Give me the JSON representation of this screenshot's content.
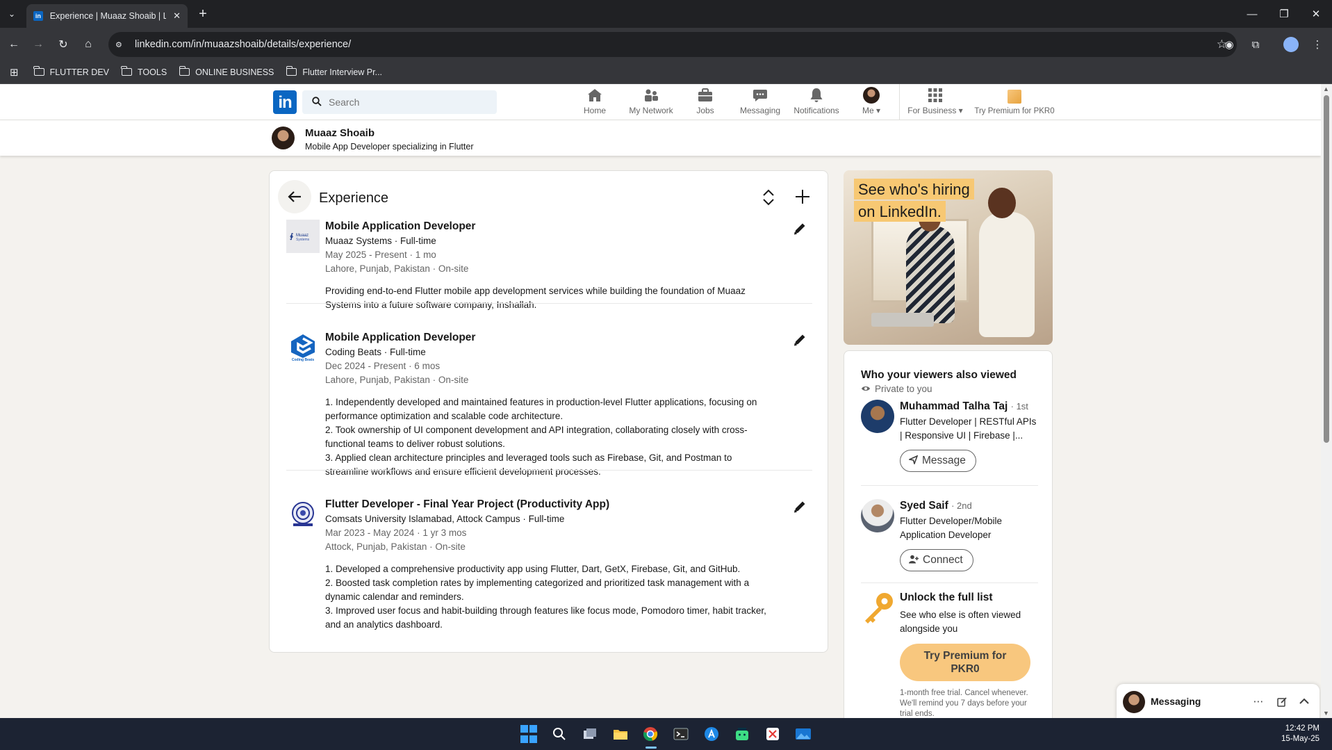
{
  "browser": {
    "tab_title": "Experience | Muaaz Shoaib | LinkedIn",
    "url": "linkedin.com/in/muaazshoaib/details/experience/",
    "bookmarks": [
      "FLUTTER DEV",
      "TOOLS",
      "ONLINE BUSINESS",
      "Flutter Interview Pr..."
    ]
  },
  "linkedin_nav": {
    "search_placeholder": "Search",
    "items": [
      {
        "label": "Home",
        "icon": "home-icon"
      },
      {
        "label": "My Network",
        "icon": "network-icon"
      },
      {
        "label": "Jobs",
        "icon": "briefcase-icon"
      },
      {
        "label": "Messaging",
        "icon": "chat-icon"
      },
      {
        "label": "Notifications",
        "icon": "bell-icon"
      },
      {
        "label": "Me",
        "icon": "profile-photo"
      }
    ],
    "for_business": "For Business",
    "premium": "Try Premium for PKR0"
  },
  "profile": {
    "name": "Muaaz Shoaib",
    "headline": "Mobile App Developer specializing in Flutter"
  },
  "experience": {
    "title": "Experience",
    "entries": [
      {
        "role": "Mobile Application Developer",
        "company": "Muaaz Systems · Full-time",
        "dates": "May 2025 - Present · 1 mo",
        "location": "Lahore, Punjab, Pakistan · On-site",
        "logo_text": "Muaaz Systems",
        "description": [
          "Providing end-to-end Flutter mobile app development services while building the foundation of Muaaz",
          "Systems into a future software company, Inshallah."
        ]
      },
      {
        "role": "Mobile Application Developer",
        "company": "Coding Beats · Full-time",
        "dates": "Dec 2024 - Present · 6 mos",
        "location": "Lahore, Punjab, Pakistan · On-site",
        "logo_text": "Coding Beats",
        "description": [
          "1. Independently developed and maintained features in production-level Flutter applications, focusing on",
          "performance optimization and scalable code architecture.",
          "2. Took ownership of UI component development and API integration, collaborating closely with cross-",
          "functional teams to deliver robust solutions.",
          "3. Applied clean architecture principles and leveraged tools such as Firebase, Git, and Postman to",
          "streamline workflows and ensure efficient development processes."
        ]
      },
      {
        "role": "Flutter Developer - Final Year Project (Productivity App)",
        "company": "Comsats University Islamabad, Attock Campus · Full-time",
        "dates": "Mar 2023 - May 2024 · 1 yr 3 mos",
        "location": "Attock, Punjab, Pakistan · On-site",
        "logo_text": "",
        "description": [
          "1. Developed a comprehensive productivity app using Flutter, Dart, GetX, Firebase, Git, and GitHub.",
          "2. Boosted task completion rates by implementing categorized and prioritized task management with a",
          "dynamic calendar and reminders.",
          "3. Improved user focus and habit-building through features like focus mode, Pomodoro timer, habit tracker,",
          "and an analytics dashboard."
        ]
      }
    ]
  },
  "ad": {
    "line1": "See who's hiring",
    "line2": "on LinkedIn."
  },
  "viewers": {
    "title": "Who your viewers also viewed",
    "private": "Private to you",
    "people": [
      {
        "name": "Muhammad Talha Taj",
        "degree": "· 1st",
        "headline_line1": "Flutter Developer | RESTful APIs",
        "headline_line2": "| Responsive UI | Firebase |...",
        "action": "Message"
      },
      {
        "name": "Syed Saif",
        "degree": "· 2nd",
        "headline_line1": "Flutter Developer/Mobile",
        "headline_line2": "Application Developer",
        "action": "Connect"
      }
    ],
    "unlock_title": "Unlock the full list",
    "unlock_desc": "See who else is often viewed alongside you",
    "premium_button_line1": "Try Premium for",
    "premium_button_line2": "PKR0",
    "trial_text": "1-month free trial. Cancel whenever. We'll remind you 7 days before your trial ends."
  },
  "messaging": {
    "label": "Messaging"
  },
  "taskbar": {
    "time": "12:42 PM",
    "date": "15-May-25"
  },
  "colors": {
    "linkedin_blue": "#0a66c2",
    "premium_gold": "#f8c77e",
    "page_bg": "#f4f2ee"
  }
}
